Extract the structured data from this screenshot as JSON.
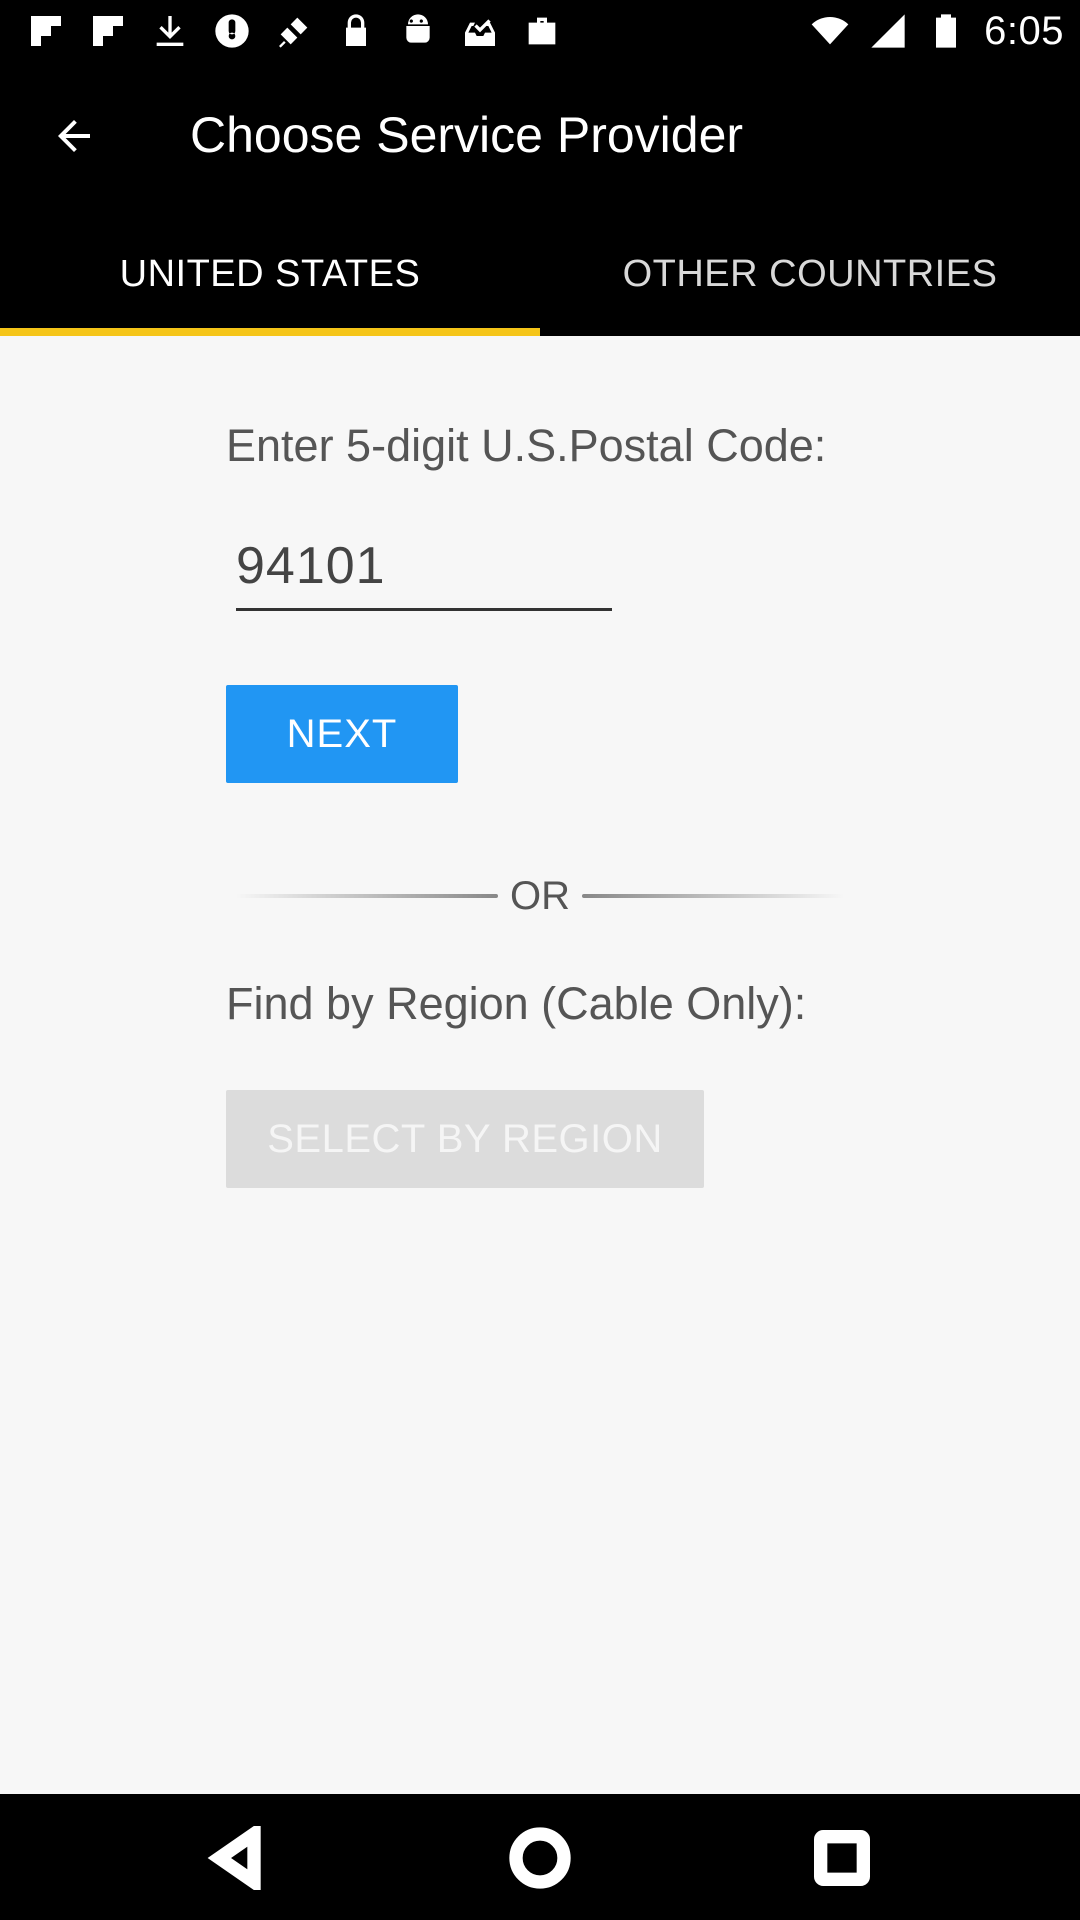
{
  "status_bar": {
    "time": "6:05",
    "icons": [
      "flipboard-icon",
      "flipboard-icon",
      "download-icon",
      "power-saver-icon",
      "fake-gps-icon",
      "lock-icon",
      "android-icon",
      "tray-check-icon",
      "briefcase-icon"
    ],
    "right_icons": [
      "wifi-icon",
      "signal-icon",
      "battery-icon"
    ]
  },
  "header": {
    "title": "Choose Service Provider",
    "back_icon": "arrow-back-icon"
  },
  "tabs": [
    {
      "label": "UNITED STATES",
      "selected": true
    },
    {
      "label": "OTHER COUNTRIES",
      "selected": false
    }
  ],
  "colors": {
    "tab_indicator": "#f5c518",
    "primary_button": "#2196f3",
    "disabled_button": "#dcdcdc",
    "background": "#f7f7f7"
  },
  "form": {
    "postal_label": "Enter 5-digit U.S.Postal Code:",
    "postal_value": "94101",
    "next_label": "NEXT",
    "or_label": "OR",
    "region_label": "Find by Region (Cable Only):",
    "region_button_label": "SELECT BY REGION"
  },
  "nav": {
    "back_icon": "nav-back-icon",
    "home_icon": "nav-home-icon",
    "recents_icon": "nav-recents-icon"
  }
}
